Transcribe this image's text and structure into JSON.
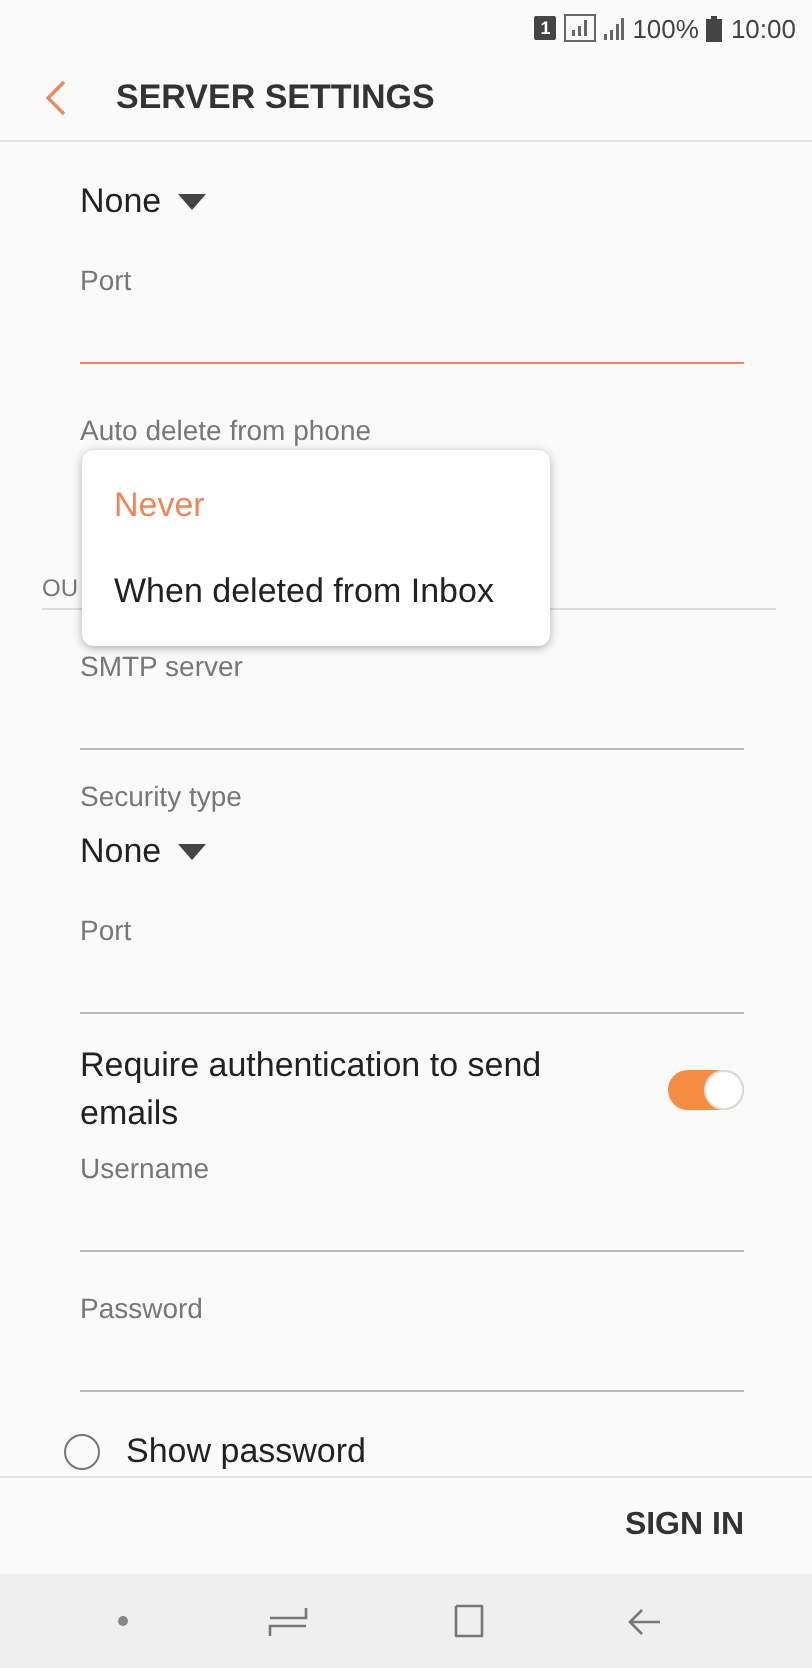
{
  "status_bar": {
    "sim_label": "1",
    "battery_percent": "100%",
    "time": "10:00"
  },
  "header": {
    "title": "SERVER SETTINGS"
  },
  "items": [
    {
      "kind": "dropdown",
      "value": "None"
    },
    {
      "kind": "field",
      "label": "Port",
      "focused": true
    },
    {
      "kind": "menu_label",
      "label": "Auto delete from phone"
    },
    {
      "kind": "section",
      "label": "OU"
    },
    {
      "kind": "field",
      "label": "SMTP server",
      "focused": false
    },
    {
      "kind": "dropdown",
      "label": "Security type",
      "value": "None"
    },
    {
      "kind": "field",
      "label": "Port",
      "focused": false
    },
    {
      "kind": "toggle",
      "label": "Require authentication to send emails",
      "on": true
    },
    {
      "kind": "field",
      "label": "Username",
      "focused": false
    },
    {
      "kind": "field",
      "label": "Password",
      "focused": false
    },
    {
      "kind": "radio",
      "label": "Show password",
      "checked": false
    }
  ],
  "popup_menu": {
    "options": [
      {
        "label": "Never",
        "selected": true
      },
      {
        "label": "When deleted from Inbox",
        "selected": false
      }
    ]
  },
  "footer": {
    "button": "SIGN IN"
  }
}
